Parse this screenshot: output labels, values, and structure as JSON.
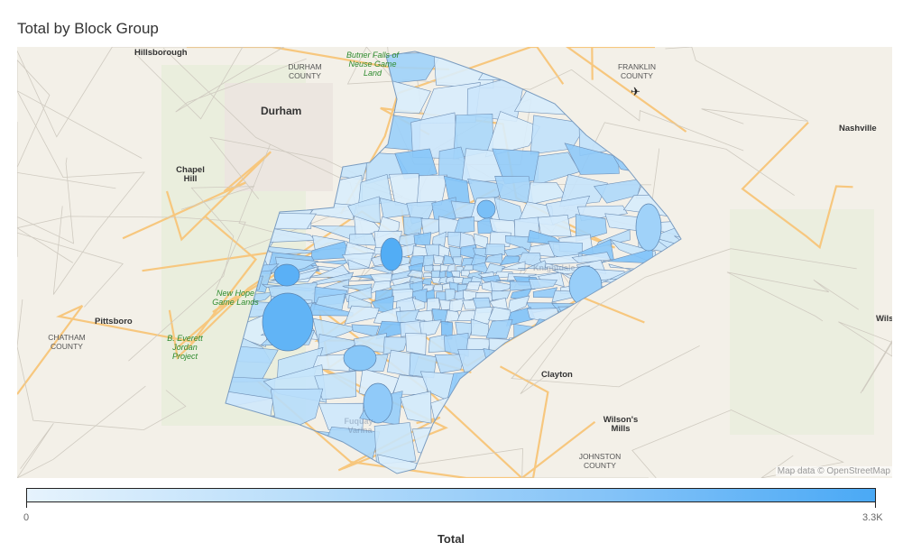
{
  "title": "Total by Block Group",
  "map": {
    "labels": {
      "hillsborough": "Hillsborough",
      "durham_county": "DURHAM COUNTY",
      "butner": "Butner Falls of Neuse Game Land",
      "franklin_county": "FRANKLIN COUNTY",
      "durham": "Durham",
      "nashville": "Nashville",
      "chapel_hill": "Chapel Hill",
      "new_hope": "New Hope Game Lands",
      "pittsboro": "Pittsboro",
      "chatham_county": "CHATHAM COUNTY",
      "jordan": "B. Everett Jordan Project",
      "clayton": "Clayton",
      "wilsons_mills": "Wilson's Mills",
      "johnston_county": "JOHNSTON COUNTY",
      "wils": "Wils",
      "knightdale": "Knightdale",
      "fuquay": "Fuquay-Varina"
    },
    "attribution": "Map data © OpenStreetMap",
    "airport_icon": "airplane-icon"
  },
  "legend": {
    "min_label": "0",
    "max_label": "3.3K",
    "title": "Total",
    "min_value": 0,
    "max_value": 3300,
    "color_low": "#e6f3fd",
    "color_high": "#4aa9f5"
  }
}
